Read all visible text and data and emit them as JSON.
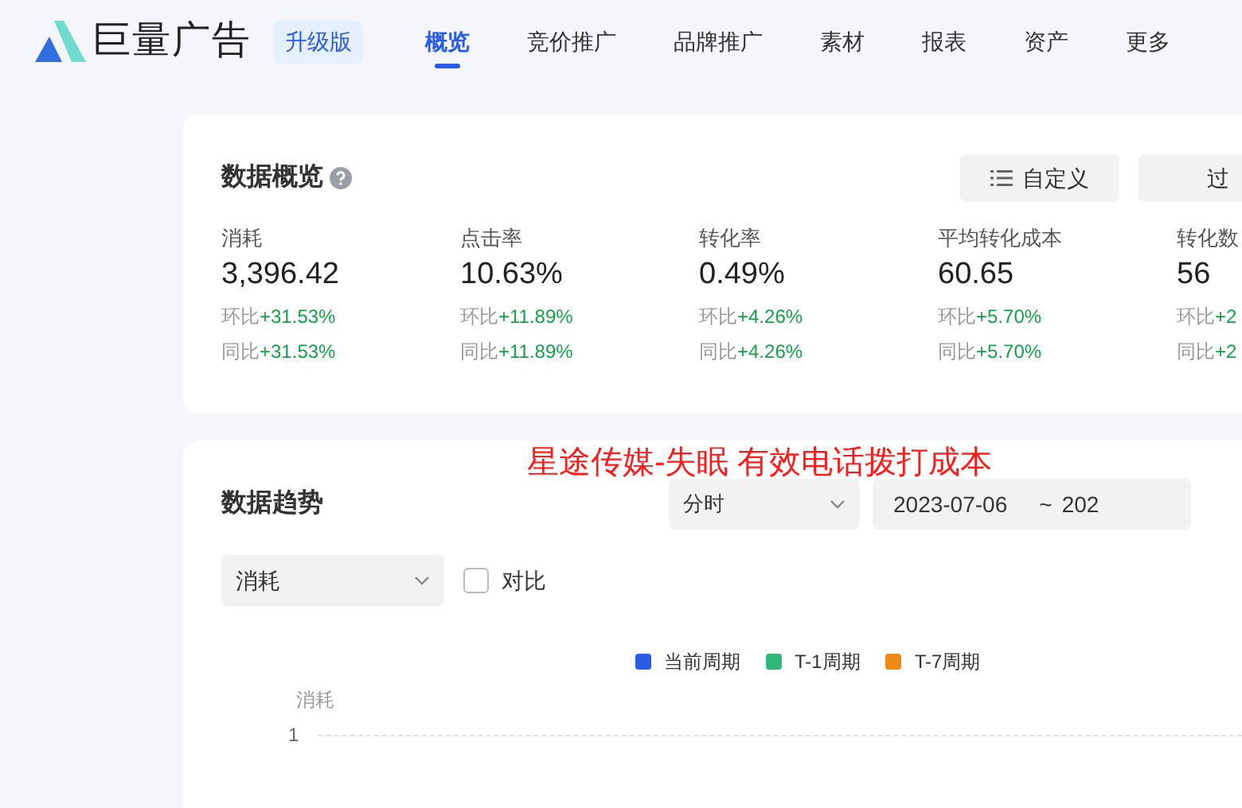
{
  "header": {
    "logo_text": "巨量广告",
    "badge": "升级版",
    "nav": [
      {
        "label": "概览",
        "selected": true
      },
      {
        "label": "竞价推广",
        "selected": false
      },
      {
        "label": "品牌推广",
        "selected": false
      },
      {
        "label": "素材",
        "selected": false
      },
      {
        "label": "报表",
        "selected": false
      },
      {
        "label": "资产",
        "selected": false
      },
      {
        "label": "更多",
        "selected": false
      }
    ]
  },
  "overview": {
    "title": "数据概览",
    "buttons": [
      {
        "label": "自定义",
        "kind": "list"
      },
      {
        "label": "过",
        "kind": "plain"
      }
    ],
    "metrics": [
      {
        "label": "消耗",
        "value": "3,396.42",
        "mom_label": "环比",
        "mom": "+31.53%",
        "yoy_label": "同比",
        "yoy": "+31.53%"
      },
      {
        "label": "点击率",
        "value": "10.63%",
        "mom_label": "环比",
        "mom": "+11.89%",
        "yoy_label": "同比",
        "yoy": "+11.89%"
      },
      {
        "label": "转化率",
        "value": "0.49%",
        "mom_label": "环比",
        "mom": "+4.26%",
        "yoy_label": "同比",
        "yoy": "+4.26%"
      },
      {
        "label": "平均转化成本",
        "value": "60.65",
        "mom_label": "环比",
        "mom": "+5.70%",
        "yoy_label": "同比",
        "yoy": "+5.70%"
      },
      {
        "label": "转化数",
        "value": "56",
        "mom_label": "环比",
        "mom": "+2",
        "yoy_label": "同比",
        "yoy": "+2"
      }
    ]
  },
  "annotation": "星途传媒-失眠 有效电话拨打成本",
  "trend": {
    "title": "数据趋势",
    "granularity": "分时",
    "date_start": "2023-07-06",
    "date_sep": "~",
    "date_end": "202",
    "metric_select": "消耗",
    "compare": {
      "label": "对比",
      "checked": false
    },
    "legend": [
      {
        "label": "当前周期",
        "color": "#2b5ce6"
      },
      {
        "label": "T-1周期",
        "color": "#2fb87a"
      },
      {
        "label": "T-7周期",
        "color": "#ef8a17"
      }
    ],
    "y_axis_label": "消耗",
    "y_tick": "1"
  }
}
